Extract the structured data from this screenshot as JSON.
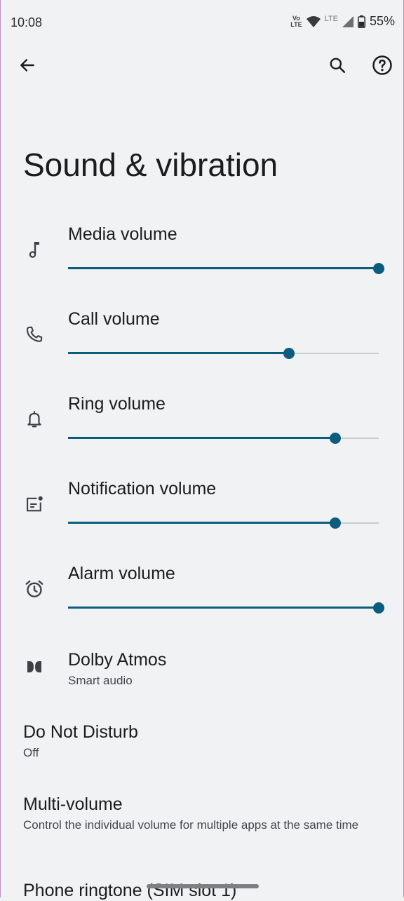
{
  "status": {
    "time": "10:08",
    "volte_top": "Vo",
    "volte_bottom": "LTE",
    "lte": "LTE",
    "battery": "55%"
  },
  "appbar": {
    "back_icon": "arrow-back-icon",
    "search_icon": "search-icon",
    "help_icon": "help-icon"
  },
  "page": {
    "title": "Sound & vibration"
  },
  "volumes": [
    {
      "label": "Media volume",
      "level": 1.0,
      "icon": "music-note-icon"
    },
    {
      "label": "Call volume",
      "level": 0.71,
      "icon": "phone-icon"
    },
    {
      "label": "Ring volume",
      "level": 0.86,
      "icon": "bell-icon"
    },
    {
      "label": "Notification volume",
      "level": 0.86,
      "icon": "notification-icon"
    },
    {
      "label": "Alarm volume",
      "level": 1.0,
      "icon": "alarm-icon"
    }
  ],
  "dolby": {
    "title": "Dolby Atmos",
    "subtitle": "Smart audio",
    "icon": "dolby-icon"
  },
  "dnd": {
    "title": "Do Not Disturb",
    "subtitle": "Off"
  },
  "multi_volume": {
    "title": "Multi-volume",
    "subtitle": "Control the individual volume for multiple apps at the same time"
  },
  "ringtone": {
    "title": "Phone ringtone (SIM slot 1)"
  },
  "colors": {
    "accent": "#0b5d7f",
    "background": "#f0f2f4",
    "track": "#c9ccd0"
  }
}
